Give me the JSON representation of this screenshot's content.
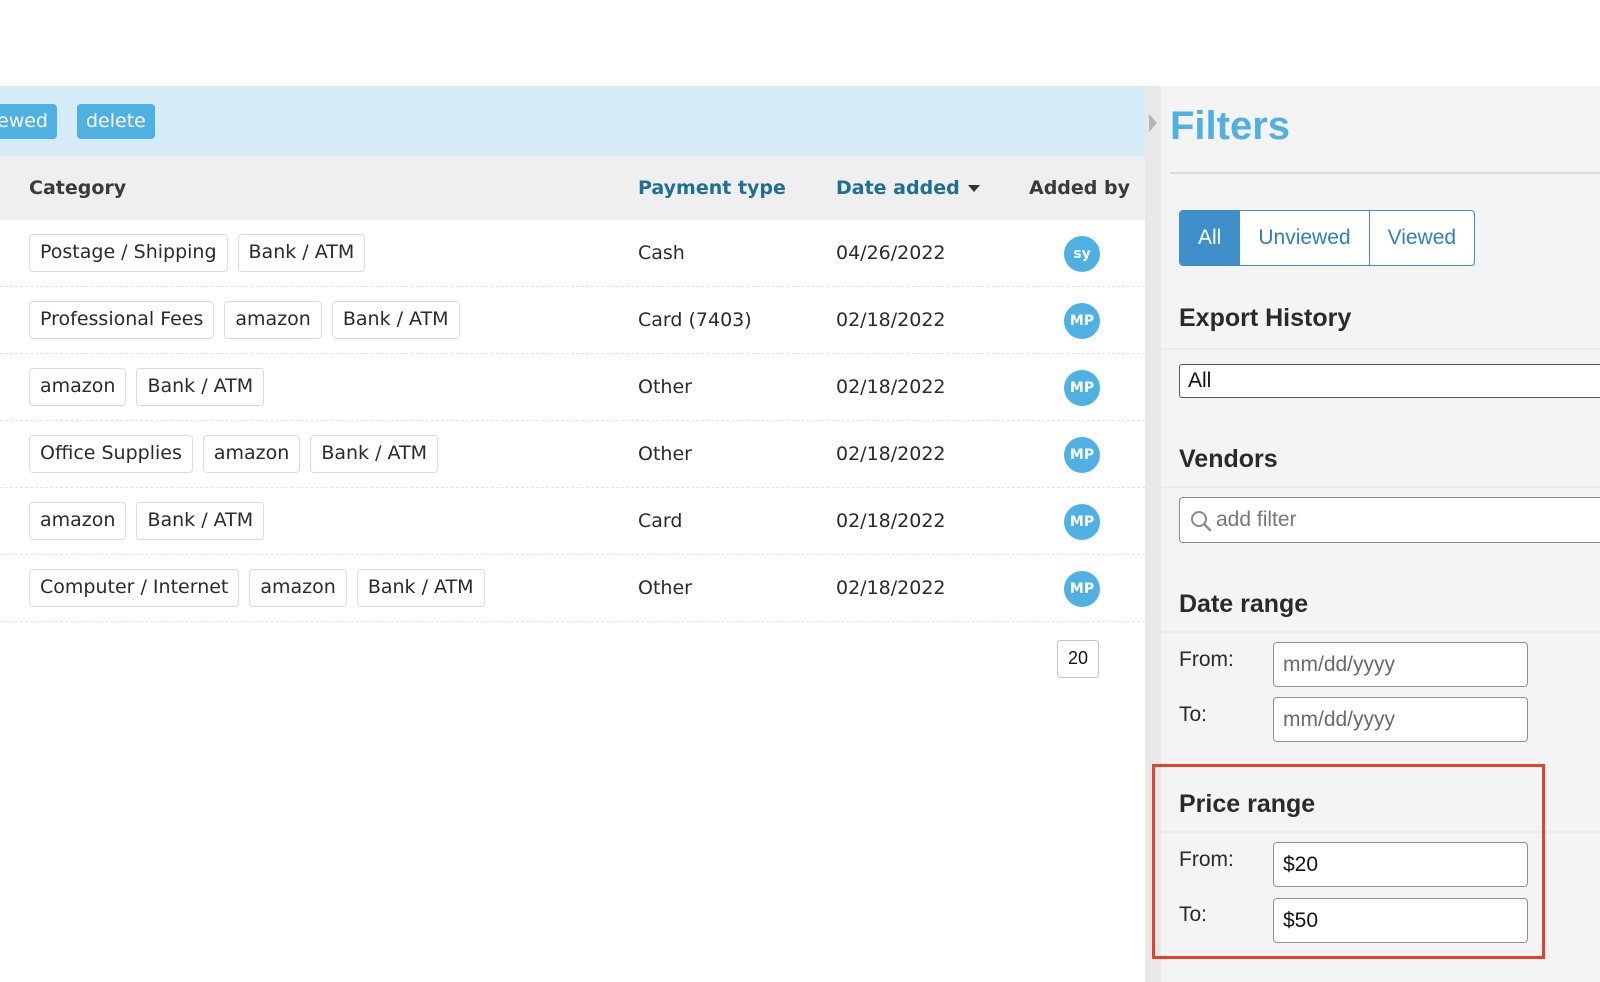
{
  "actions": {
    "viewed_label": "ewed",
    "delete_label": "delete"
  },
  "table": {
    "headers": {
      "category": "Category",
      "payment_type": "Payment type",
      "date_added": "Date added",
      "added_by": "Added by"
    },
    "rows": [
      {
        "tags": [
          "Postage / Shipping",
          "Bank / ATM"
        ],
        "payment": "Cash",
        "date": "04/26/2022",
        "added_by": "sy"
      },
      {
        "tags": [
          "Professional Fees",
          "amazon",
          "Bank / ATM"
        ],
        "payment": "Card (7403)",
        "date": "02/18/2022",
        "added_by": "MP"
      },
      {
        "tags": [
          "amazon",
          "Bank / ATM"
        ],
        "payment": "Other",
        "date": "02/18/2022",
        "added_by": "MP"
      },
      {
        "tags": [
          "Office Supplies",
          "amazon",
          "Bank / ATM"
        ],
        "payment": "Other",
        "date": "02/18/2022",
        "added_by": "MP"
      },
      {
        "tags": [
          "amazon",
          "Bank / ATM"
        ],
        "payment": "Card",
        "date": "02/18/2022",
        "added_by": "MP"
      },
      {
        "tags": [
          "Computer / Internet",
          "amazon",
          "Bank / ATM"
        ],
        "payment": "Other",
        "date": "02/18/2022",
        "added_by": "MP"
      }
    ],
    "page_size": "20"
  },
  "filters": {
    "title": "Filters",
    "view_segments": [
      {
        "label": "All",
        "active": true
      },
      {
        "label": "Unviewed",
        "active": false
      },
      {
        "label": "Viewed",
        "active": false
      }
    ],
    "export_history": {
      "title": "Export History",
      "value": "All"
    },
    "vendors": {
      "title": "Vendors",
      "placeholder": "add filter"
    },
    "date_range": {
      "title": "Date range",
      "from_label": "From:",
      "to_label": "To:",
      "from_placeholder": "mm/dd/yyyy",
      "to_placeholder": "mm/dd/yyyy"
    },
    "price_range": {
      "title": "Price range",
      "from_label": "From:",
      "to_label": "To:",
      "from_value": "$20",
      "to_value": "$50"
    }
  },
  "colors": {
    "accent": "#4fb1e3",
    "segment_active": "#3f8fca",
    "header_link": "#1e6f95",
    "highlight": "#e1432e"
  }
}
